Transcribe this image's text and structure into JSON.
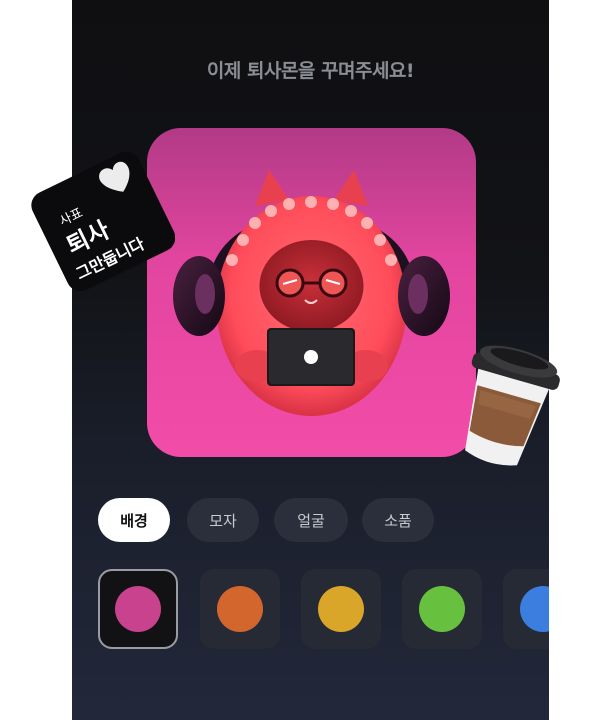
{
  "header": {
    "title": "이제 퇴사몬을 꾸며주세요!"
  },
  "sticker": {
    "line1": "사표",
    "line2": "퇴사",
    "line3": "그만둡니다"
  },
  "tabs": [
    {
      "label": "배경",
      "active": true
    },
    {
      "label": "모자",
      "active": false
    },
    {
      "label": "얼굴",
      "active": false
    },
    {
      "label": "소품",
      "active": false
    }
  ],
  "swatches": [
    {
      "color": "#c8428e",
      "selected": true
    },
    {
      "color": "#d3662d",
      "selected": false
    },
    {
      "color": "#d9a62a",
      "selected": false
    },
    {
      "color": "#67c13f",
      "selected": false
    },
    {
      "color": "#3c7de0",
      "selected": false
    }
  ],
  "colors": {
    "card_bg": "#f24ca8",
    "character": "#ff5a6b",
    "accent_white": "#ffffff"
  }
}
